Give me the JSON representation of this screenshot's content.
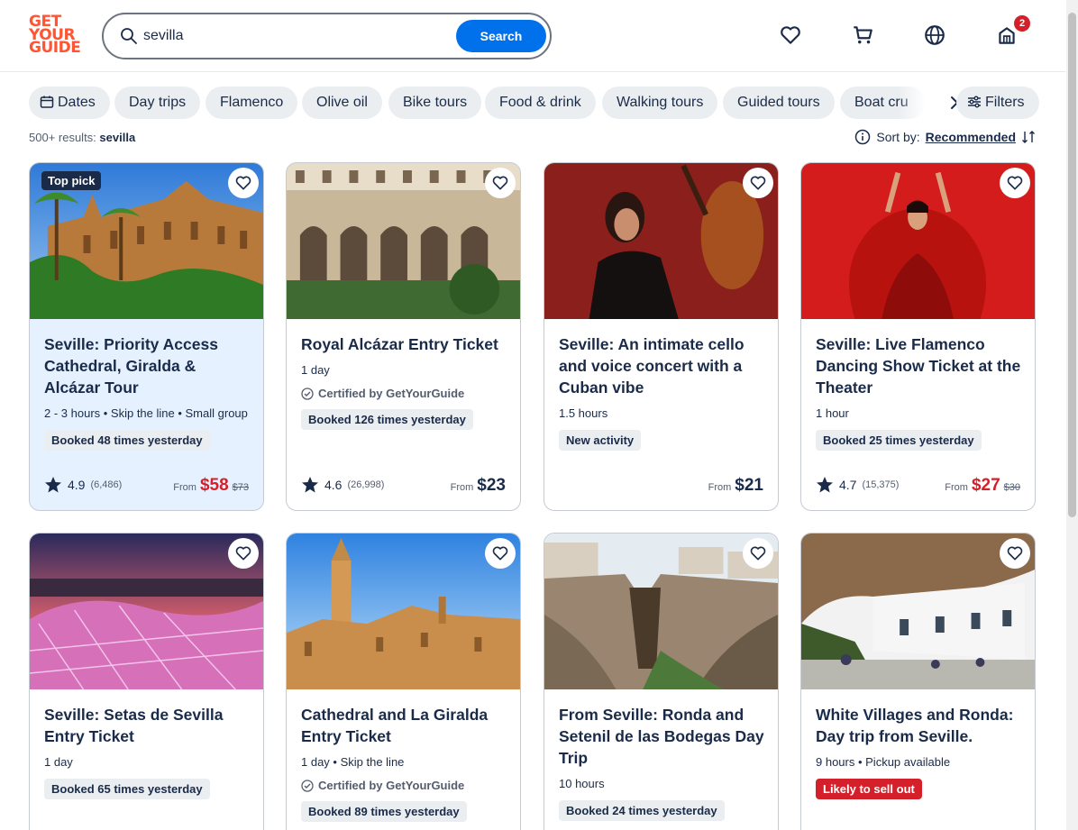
{
  "header": {
    "logo_lines": [
      "GET",
      "YOUR",
      "GUIDE"
    ],
    "search": {
      "value": "sevilla",
      "button_label": "Search"
    },
    "cart_count": "2"
  },
  "chips": {
    "items": [
      "Dates",
      "Day trips",
      "Flamenco",
      "Olive oil",
      "Bike tours",
      "Food & drink",
      "Walking tours",
      "Guided tours",
      "Boat cru"
    ],
    "filters_label": "Filters"
  },
  "results": {
    "count_text": "500+ results:",
    "query": "sevilla"
  },
  "sort": {
    "label": "Sort by:",
    "value": "Recommended"
  },
  "cards": [
    {
      "title": "Seville: Priority Access Cathedral, Giralda & Alcázar Tour",
      "badge": "Top pick",
      "meta": "2 - 3 hours • Skip the line • Small group",
      "tag": "Booked 48 times yesterday",
      "rating": "4.9",
      "reviews": "(6,486)",
      "from": "From",
      "price": "$58",
      "old_price": "$73"
    },
    {
      "title": "Royal Alcázar Entry Ticket",
      "meta": "1 day",
      "cert": "Certified by GetYourGuide",
      "tag": "Booked 126 times yesterday",
      "rating": "4.6",
      "reviews": "(26,998)",
      "from": "From",
      "price": "$23"
    },
    {
      "title": "Seville: An intimate cello and voice concert with a Cuban vibe",
      "meta": "1.5 hours",
      "tag": "New activity",
      "from": "From",
      "price": "$21"
    },
    {
      "title": "Seville: Live Flamenco Dancing Show Ticket at the Theater",
      "meta": "1 hour",
      "tag": "Booked 25 times yesterday",
      "rating": "4.7",
      "reviews": "(15,375)",
      "from": "From",
      "price": "$27",
      "old_price": "$30"
    },
    {
      "title": "Seville: Setas de Sevilla Entry Ticket",
      "meta": "1 day",
      "tag": "Booked 65 times yesterday"
    },
    {
      "title": "Cathedral and La Giralda Entry Ticket",
      "meta": "1 day • Skip the line",
      "cert": "Certified by GetYourGuide",
      "tag": "Booked 89 times yesterday"
    },
    {
      "title": "From Seville: Ronda and Setenil de las Bodegas Day Trip",
      "meta": "10 hours",
      "tag": "Booked 24 times yesterday"
    },
    {
      "title": "White Villages and Ronda: Day trip from Seville.",
      "meta": "9 hours • Pickup available",
      "tag": "Likely to sell out"
    }
  ],
  "colors": {
    "brand": "#ff5533",
    "primary": "#0071eb",
    "sale": "#d4202a",
    "text": "#1a2b49"
  }
}
